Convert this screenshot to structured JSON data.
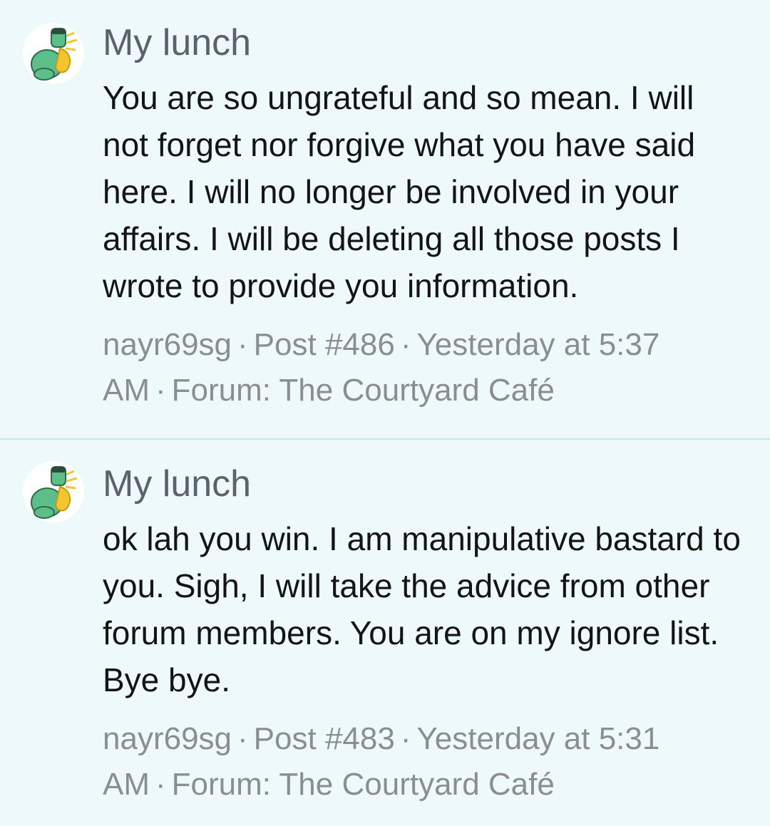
{
  "results": [
    {
      "title": "My lunch",
      "snippet": "You are so ungrateful and so mean. I will not forget nor forgive what you have said here. I will no longer be involved in your affairs. I will be deleting all those posts I wrote to provide you information.",
      "author": "nayr69sg",
      "post_number": "Post #486",
      "timestamp": "Yesterday at 5:37 AM",
      "forum": "Forum: The Courtyard Café",
      "avatar_icon": "hulk-avatar-icon"
    },
    {
      "title": "My lunch",
      "snippet": "ok lah you win. I am manipulative bastard to you. Sigh, I will take the advice from other forum members. You are on my ignore list. Bye bye.",
      "author": "nayr69sg",
      "post_number": "Post #483",
      "timestamp": "Yesterday at 5:31 AM",
      "forum": "Forum: The Courtyard Café",
      "avatar_icon": "hulk-avatar-icon"
    }
  ],
  "meta_separator": "·",
  "colors": {
    "background": "#eef9fb",
    "divider": "#c6e5ec",
    "title": "#5b6368",
    "body_text": "#141414",
    "meta_text": "#8a8e92",
    "avatar_green": "#5cbf8a",
    "avatar_yellow": "#f5c531",
    "avatar_purple": "#7a4fa3"
  }
}
